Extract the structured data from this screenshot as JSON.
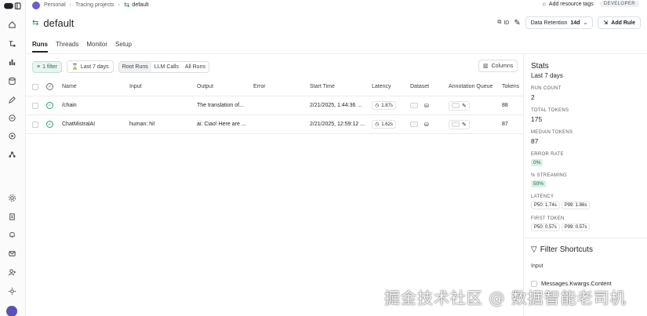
{
  "breadcrumb": {
    "workspace": "Personal",
    "section": "Tracing projects",
    "current": "default"
  },
  "topbar": {
    "add_tags": "Add resource tags",
    "badge": "DEVELOPER"
  },
  "project": {
    "title": "default",
    "id_label": "ID",
    "retention_label": "Data Retention",
    "retention_value": "14d",
    "add_rule": "Add Rule"
  },
  "tabs": [
    "Runs",
    "Threads",
    "Monitor",
    "Setup"
  ],
  "filters": {
    "filter": "1 filter",
    "range": "Last 7 days",
    "modes": [
      "Root Runs",
      "LLM Calls",
      "All Runs"
    ],
    "columns": "Columns"
  },
  "table": {
    "headers": [
      "Name",
      "Input",
      "Output",
      "Error",
      "Start Time",
      "Latency",
      "Dataset",
      "Annotation Queue",
      "Tokens"
    ],
    "rows": [
      {
        "name": "/chain",
        "input": "",
        "output": "The translation of...",
        "error": "",
        "start": "2/21/2025, 1:44:36 ...",
        "latency": "1.87s",
        "tokens": "88"
      },
      {
        "name": "ChatMistralAI",
        "input": "human: hi!",
        "output": "ai: Ciao! Here are ...",
        "error": "",
        "start": "2/21/2025, 12:59:12 ...",
        "latency": "1.62s",
        "tokens": "87"
      }
    ]
  },
  "stats": {
    "title": "Stats",
    "range": "Last 7 days",
    "run_count_label": "RUN COUNT",
    "run_count": "2",
    "total_tokens_label": "TOTAL TOKENS",
    "total_tokens": "175",
    "median_tokens_label": "MEDIAN TOKENS",
    "median_tokens": "87",
    "error_rate_label": "ERROR RATE",
    "error_rate": "0%",
    "streaming_label": "% STREAMING",
    "streaming": "50%",
    "latency_label": "LATENCY",
    "latency_p50": "P50: 1.74s",
    "latency_p99": "P99: 1.86s",
    "first_token_label": "FIRST TOKEN",
    "first_token_p50": "P50: 0.57s",
    "first_token_p99": "P99: 0.57s"
  },
  "filter_shortcuts": {
    "title": "Filter Shortcuts",
    "input": "Input",
    "item": "Messages.Kwargs.Content"
  },
  "watermark": "掘金技术社区 @ 数据智能老司机",
  "colors": {
    "accent": "#2f9e6e",
    "badge_green": "#d8f1e5"
  }
}
